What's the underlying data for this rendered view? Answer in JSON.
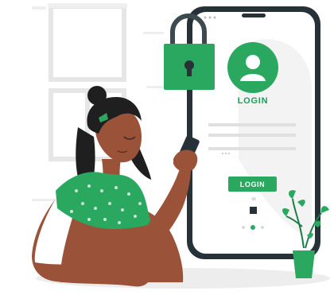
{
  "phone_screen": {
    "login_title": "LOGIN",
    "login_button_label": "LOGIN",
    "divider_text": "or"
  },
  "colors": {
    "brand_green": "#2aa85f",
    "dark_green": "#1e7d46",
    "skin": "#9a5238",
    "hair": "#1f1f1f",
    "phone_frame": "#263238"
  }
}
